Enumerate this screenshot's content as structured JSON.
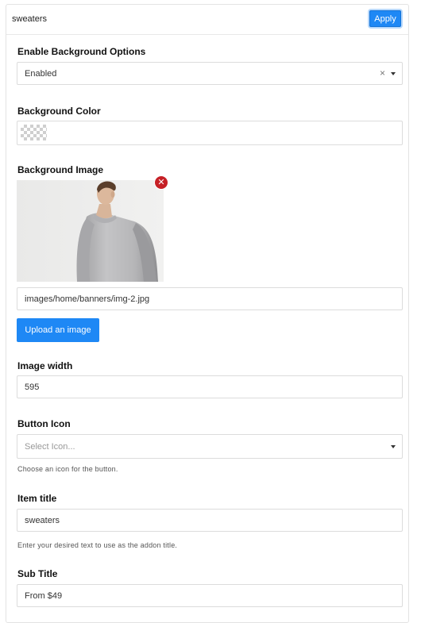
{
  "header": {
    "title": "sweaters",
    "apply_label": "Apply"
  },
  "bg_options": {
    "label": "Enable Background Options",
    "value": "Enabled",
    "clear_glyph": "×"
  },
  "bg_color": {
    "label": "Background Color",
    "value": "transparent"
  },
  "bg_image": {
    "label": "Background Image",
    "remove_glyph": "✕",
    "path": "images/home/banners/img-2.jpg",
    "upload_label": "Upload an image"
  },
  "image_width": {
    "label": "Image width",
    "value": "595"
  },
  "button_icon": {
    "label": "Button Icon",
    "placeholder": "Select Icon...",
    "help": "Choose an icon for the button."
  },
  "item_title": {
    "label": "Item title",
    "value": "sweaters",
    "help": "Enter your desired text to use as the addon title."
  },
  "sub_title": {
    "label": "Sub Title",
    "value": "From $49"
  },
  "colors": {
    "accent": "#1e88f5",
    "remove": "#c62026",
    "border": "#dcdcdc"
  }
}
